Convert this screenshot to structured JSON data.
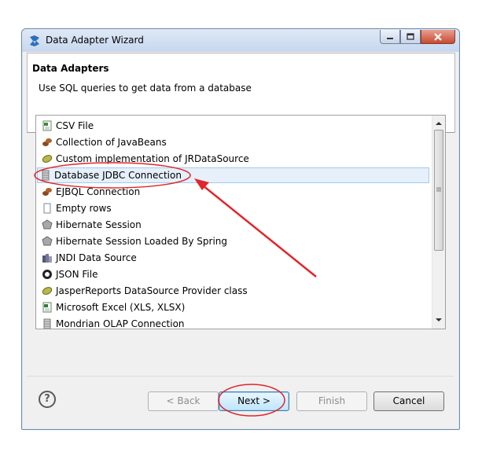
{
  "window": {
    "title": "Data Adapter Wizard",
    "caption_buttons": [
      "minimize-icon",
      "maximize-icon",
      "close-icon"
    ]
  },
  "header": {
    "title": "Data Adapters",
    "description": "Use SQL queries to get data from a database"
  },
  "adapter_list": {
    "selected_index": 3,
    "items": [
      {
        "label": "CSV File",
        "icon": "csv-file-icon"
      },
      {
        "label": "Collection of JavaBeans",
        "icon": "javabeans-icon"
      },
      {
        "label": "Custom implementation of JRDataSource",
        "icon": "jrdatasource-icon"
      },
      {
        "label": "Database JDBC Connection",
        "icon": "database-icon"
      },
      {
        "label": "EJBQL Connection",
        "icon": "javabeans-icon"
      },
      {
        "label": "Empty rows",
        "icon": "empty-rows-icon"
      },
      {
        "label": "Hibernate Session",
        "icon": "hibernate-icon"
      },
      {
        "label": "Hibernate Session Loaded By Spring",
        "icon": "hibernate-icon"
      },
      {
        "label": "JNDI Data Source",
        "icon": "jndi-icon"
      },
      {
        "label": "JSON File",
        "icon": "json-icon"
      },
      {
        "label": "JasperReports DataSource Provider class",
        "icon": "jrdatasource-icon"
      },
      {
        "label": "Microsoft Excel (XLS, XLSX)",
        "icon": "excel-icon"
      },
      {
        "label": "Mondrian OLAP Connection",
        "icon": "database-icon"
      }
    ]
  },
  "buttons": {
    "help": "?",
    "back": "< Back",
    "next": "Next >",
    "finish": "Finish",
    "cancel": "Cancel"
  },
  "annotations": {
    "highlight_color": "#e0262b"
  }
}
